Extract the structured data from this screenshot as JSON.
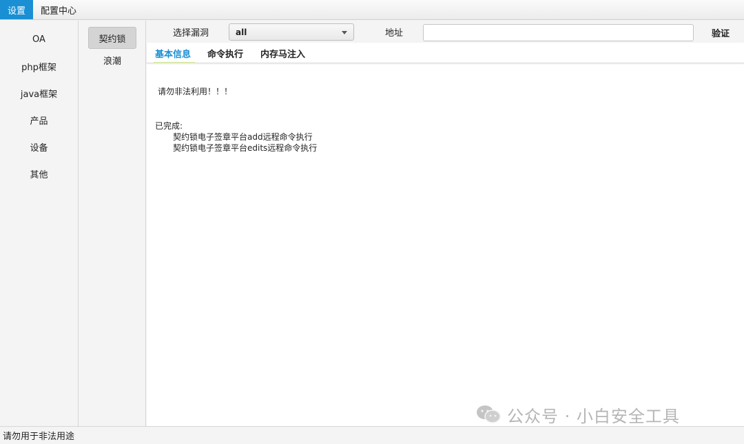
{
  "menubar": {
    "items": [
      {
        "label": "设置",
        "active": true
      },
      {
        "label": "配置中心",
        "active": false
      }
    ]
  },
  "categories": [
    "OA",
    "php框架",
    "java框架",
    "产品",
    "设备",
    "其他"
  ],
  "vendors": [
    {
      "label": "契约锁",
      "selected": true
    },
    {
      "label": "浪潮",
      "selected": false
    }
  ],
  "toolbar": {
    "vuln_label": "选择漏洞",
    "vuln_value": "all",
    "address_label": "地址",
    "address_value": "",
    "verify_label": "验证"
  },
  "tabs": [
    {
      "label": "基本信息",
      "active": true
    },
    {
      "label": "命令执行",
      "active": false
    },
    {
      "label": "内存马注入",
      "active": false
    }
  ],
  "content": {
    "warning": "请勿非法利用！！！",
    "done_title": "已完成:",
    "done_items": [
      "契约锁电子签章平台add远程命令执行",
      "契约锁电子签章平台edits远程命令执行"
    ]
  },
  "watermark": {
    "text": "公众号 · 小白安全工具"
  },
  "status": {
    "text": "请勿用于非法用途"
  },
  "colors": {
    "accent": "#1a8fd3",
    "watermark": "#b5b5b5"
  }
}
